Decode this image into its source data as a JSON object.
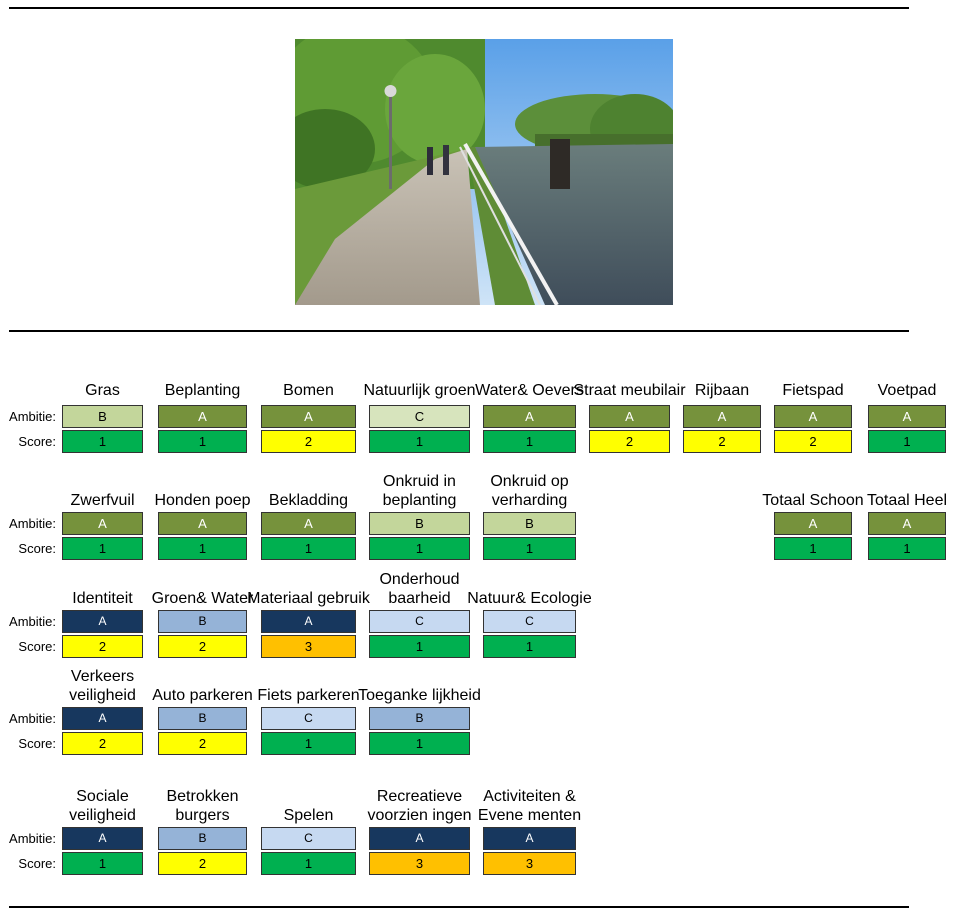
{
  "labels": {
    "ambitie": "Ambitie:",
    "score": "Score:"
  },
  "colors": {
    "grade_A_green": "#76923c",
    "grade_B_green": "#c3d69b",
    "grade_C_green": "#d7e4bd",
    "grade_A_blue": "#17375e",
    "grade_B_blue": "#95b3d7",
    "grade_C_blue": "#c6d9f1",
    "score_1": "#00b050",
    "score_2": "#ffff00",
    "score_3": "#ffc000"
  },
  "photo": {
    "icon": "park-canal-photo"
  },
  "groups": [
    {
      "items": [
        {
          "title": "Gras",
          "ambitie": "B",
          "score": "1"
        },
        {
          "title": "Beplanting",
          "ambitie": "A",
          "score": "1"
        },
        {
          "title": "Bomen",
          "ambitie": "A",
          "score": "2"
        },
        {
          "title": "Natuurlijk groen",
          "ambitie": "C",
          "score": "1"
        },
        {
          "title": "Water& Oevers",
          "ambitie": "A",
          "score": "1"
        },
        {
          "title": "Straat meubilair",
          "ambitie": "A",
          "score": "2"
        },
        {
          "title": "Rijbaan",
          "ambitie": "A",
          "score": "2"
        },
        {
          "title": "Fietspad",
          "ambitie": "A",
          "score": "2"
        },
        {
          "title": "Voetpad",
          "ambitie": "A",
          "score": "1"
        }
      ]
    },
    {
      "items": [
        {
          "title": "Zwerfvuil",
          "ambitie": "A",
          "score": "1"
        },
        {
          "title": "Honden poep",
          "ambitie": "A",
          "score": "1"
        },
        {
          "title": "Bekladding",
          "ambitie": "A",
          "score": "1"
        },
        {
          "title": "Onkruid in beplanting",
          "ambitie": "B",
          "score": "1"
        },
        {
          "title": "Onkruid op verharding",
          "ambitie": "B",
          "score": "1"
        },
        {
          "title": "Totaal Schoon",
          "ambitie": "A",
          "score": "1"
        },
        {
          "title": "Totaal Heel",
          "ambitie": "A",
          "score": "1"
        }
      ]
    },
    {
      "items": [
        {
          "title": "Identiteit",
          "ambitie": "A",
          "score": "2"
        },
        {
          "title": "Groen& Water",
          "ambitie": "B",
          "score": "2"
        },
        {
          "title": "Materiaal gebruik",
          "ambitie": "A",
          "score": "3"
        },
        {
          "title": "Onderhoud baarheid",
          "ambitie": "C",
          "score": "1"
        },
        {
          "title": "Natuur& Ecologie",
          "ambitie": "C",
          "score": "1"
        }
      ]
    },
    {
      "items": [
        {
          "title": "Verkeers veiligheid",
          "ambitie": "A",
          "score": "2"
        },
        {
          "title": "Auto parkeren",
          "ambitie": "B",
          "score": "2"
        },
        {
          "title": "Fiets parkeren",
          "ambitie": "C",
          "score": "1"
        },
        {
          "title": "Toeganke lijkheid",
          "ambitie": "B",
          "score": "1"
        }
      ]
    },
    {
      "items": [
        {
          "title": "Sociale veiligheid",
          "ambitie": "A",
          "score": "1"
        },
        {
          "title": "Betrokken burgers",
          "ambitie": "B",
          "score": "2"
        },
        {
          "title": "Spelen",
          "ambitie": "C",
          "score": "1"
        },
        {
          "title": "Recreatieve voorzien ingen",
          "ambitie": "A",
          "score": "3"
        },
        {
          "title": "Activiteiten & Evene menten",
          "ambitie": "A",
          "score": "3"
        }
      ]
    }
  ]
}
